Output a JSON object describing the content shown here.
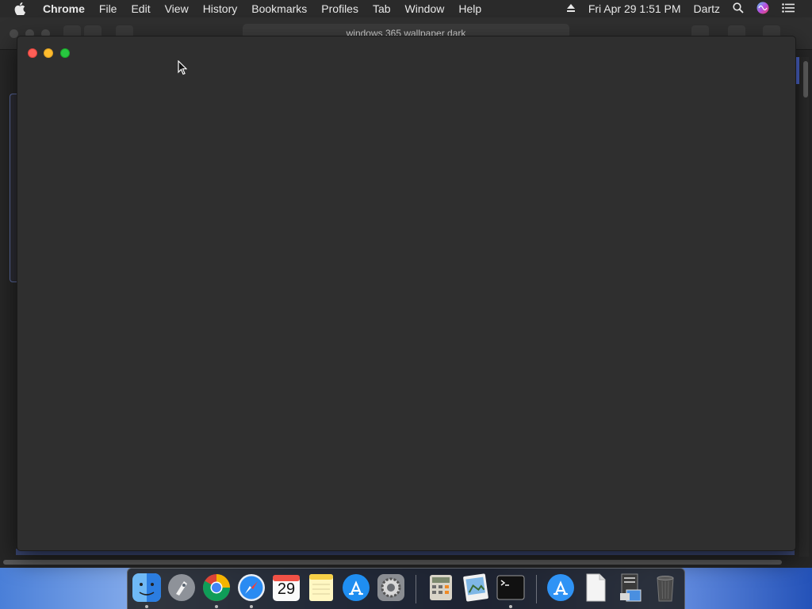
{
  "menubar": {
    "app_name": "Chrome",
    "items": [
      "File",
      "Edit",
      "View",
      "History",
      "Bookmarks",
      "Profiles",
      "Tab",
      "Window",
      "Help"
    ],
    "datetime": "Fri Apr 29  1:51 PM",
    "user": "Dartz"
  },
  "background_window": {
    "url_text": "windows 365 wallpaper dark"
  },
  "dock": {
    "calendar_day": "29"
  },
  "colors": {
    "close": "#ff5f57",
    "minimize": "#febc2e",
    "maximize": "#28c840"
  }
}
